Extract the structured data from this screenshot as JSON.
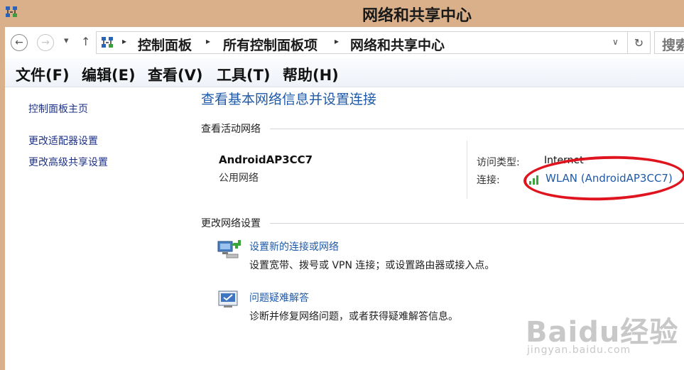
{
  "window": {
    "title": "网络和共享中心"
  },
  "nav": {
    "back_glyph": "←",
    "forward_glyph": "→",
    "history_glyph": "▾",
    "up_glyph": "↑",
    "breadcrumbs": [
      "控制面板",
      "所有控制面板项",
      "网络和共享中心"
    ],
    "separator_glyph": "▸",
    "dropdown_glyph": "∨",
    "refresh_glyph": "↻",
    "search_placeholder": "搜索"
  },
  "menu": [
    "文件(F)",
    "编辑(E)",
    "查看(V)",
    "工具(T)",
    "帮助(H)"
  ],
  "sidebar": {
    "items": [
      {
        "label": "控制面板主页"
      },
      {
        "label": "更改适配器设置"
      },
      {
        "label": "更改高级共享设置"
      }
    ]
  },
  "main": {
    "heading": "查看基本网络信息并设置连接",
    "active_networks_label": "查看活动网络",
    "network": {
      "name": "AndroidAP3CC7",
      "type": "公用网络",
      "access_type_label": "访问类型:",
      "access_type_value": "Internet",
      "connection_label": "连接:",
      "connection_value": "WLAN (AndroidAP3CC7)"
    },
    "change_settings_label": "更改网络设置",
    "tasks": [
      {
        "link": "设置新的连接或网络",
        "desc": "设置宽带、拨号或 VPN 连接；或设置路由器或接入点。",
        "icon": "new-connection-icon"
      },
      {
        "link": "问题疑难解答",
        "desc": "诊断并修复网络问题，或者获得疑难解答信息。",
        "icon": "troubleshoot-icon"
      }
    ]
  },
  "watermark": {
    "brand": "Baidu经验",
    "url": "jingyan.baidu.com"
  },
  "colors": {
    "title_bar": "#d9b08a",
    "link_blue": "#1e5aa8",
    "annotation_red": "#e0141e"
  }
}
